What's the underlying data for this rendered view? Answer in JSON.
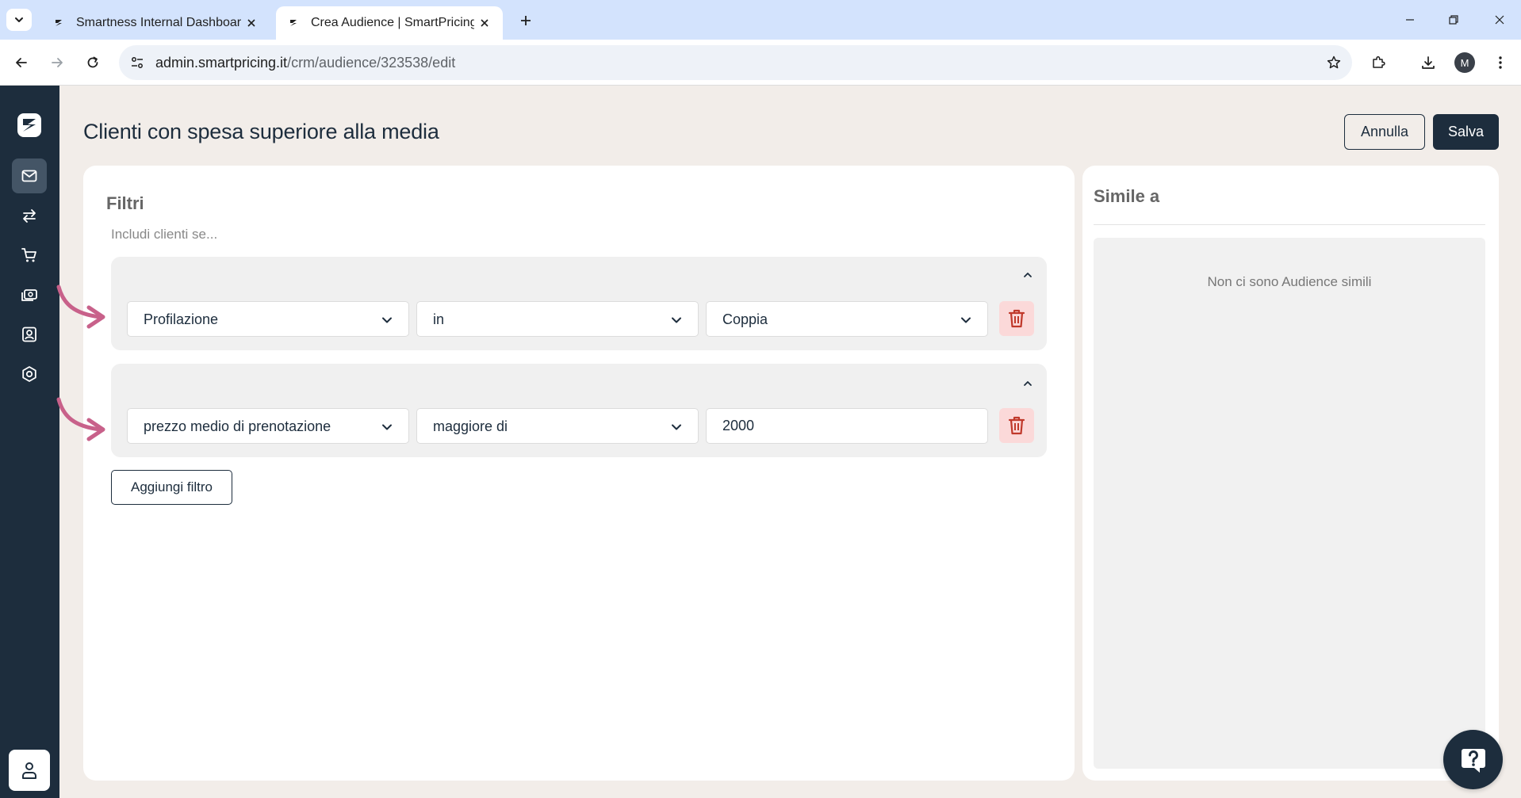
{
  "browser": {
    "tabs": [
      {
        "title": "Smartness Internal Dashboard",
        "active": false
      },
      {
        "title": "Crea Audience | SmartPricing",
        "active": true
      }
    ],
    "url_domain": "admin.smartpricing.it",
    "url_path": "/crm/audience/323538/edit",
    "profile_initial": "M"
  },
  "sidebar": {
    "items": [
      {
        "icon": "mail-icon",
        "active": true
      },
      {
        "icon": "arrows-swap-icon",
        "active": false
      },
      {
        "icon": "cart-icon",
        "active": false
      },
      {
        "icon": "money-icon",
        "active": false
      },
      {
        "icon": "contact-icon",
        "active": false
      },
      {
        "icon": "settings-icon",
        "active": false
      }
    ],
    "footer_icon": "user-icon"
  },
  "header": {
    "title": "Clienti con spesa superiore alla media",
    "cancel_label": "Annulla",
    "save_label": "Salva"
  },
  "filters": {
    "title": "Filtri",
    "subtitle": "Includi clienti se...",
    "groups": [
      {
        "field": "Profilazione",
        "operator": "in",
        "value": "Coppia",
        "value_type": "select"
      },
      {
        "field": "prezzo medio di prenotazione",
        "operator": "maggiore di",
        "value": "2000",
        "value_type": "input"
      }
    ],
    "add_label": "Aggiungi filtro"
  },
  "similar": {
    "title": "Simile a",
    "empty_text": "Non ci sono Audience simili"
  },
  "colors": {
    "primary": "#1d2d3d",
    "page_bg": "#f2ede9",
    "danger_bg": "#fbd9d9",
    "danger": "#c0392b",
    "annotation_arrow": "#c8618a"
  }
}
